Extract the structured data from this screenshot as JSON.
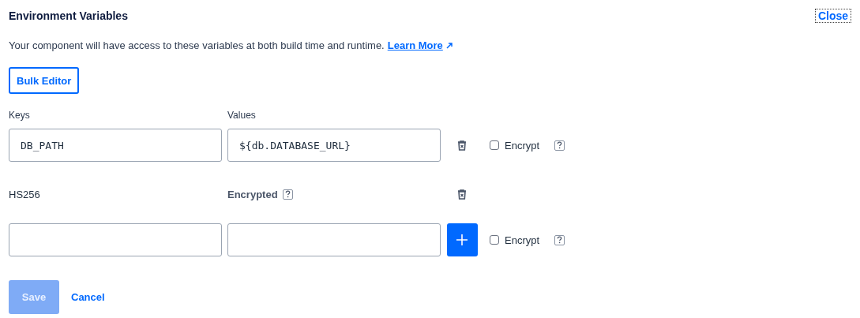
{
  "title": "Environment Variables",
  "close": "Close",
  "description": "Your component will have access to these variables at both build time and runtime.",
  "learn_more": "Learn More",
  "bulk_editor": "Bulk Editor",
  "columns": [
    "Keys",
    "Values"
  ],
  "rows": [
    {
      "kind": "editable",
      "key": "DB_PATH",
      "value": "${db.DATABASE_URL}",
      "encrypt_label": "Encrypt",
      "checked": false
    },
    {
      "kind": "encrypted",
      "key": "HS256",
      "value": "Encrypted"
    },
    {
      "kind": "new",
      "encrypt_label": "Encrypt",
      "checked": false
    }
  ],
  "save": {
    "label": "Save",
    "disabled": true
  },
  "cancel": "Cancel"
}
